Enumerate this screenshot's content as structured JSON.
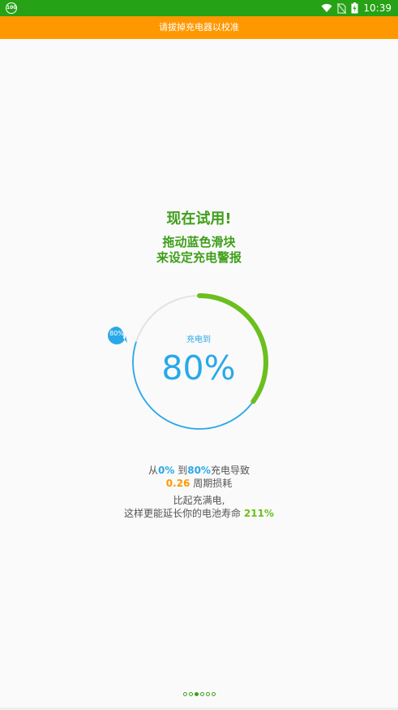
{
  "status_bar": {
    "left_badge": "100",
    "time": "10:39",
    "icons": [
      "wifi-icon",
      "no-sim-icon",
      "battery-charging-icon"
    ]
  },
  "banner": {
    "text": "请拔掉充电器以校准"
  },
  "intro": {
    "title": "现在试用!",
    "line1": "拖动蓝色滑块",
    "line2": "来设定充电警报"
  },
  "gauge": {
    "label": "充电到",
    "value": "80%",
    "handle_label": "80%",
    "current_fraction": 0.35,
    "target_fraction": 0.8,
    "colors": {
      "progress": "#6bbf1e",
      "target": "#29a9e8",
      "track": "#e0e0e0"
    }
  },
  "info": {
    "from_prefix": "从",
    "from_value": "0%",
    "to_word": " 到",
    "to_value": "80%",
    "to_suffix": "充电导致",
    "cycles_value": "0.26",
    "cycles_text": " 周期损耗",
    "compare_line": "比起充满电,",
    "extend_text": "这样更能延长你的电池寿命 ",
    "extend_value": "211%"
  },
  "pager": {
    "count": 6,
    "active_index": 2
  }
}
